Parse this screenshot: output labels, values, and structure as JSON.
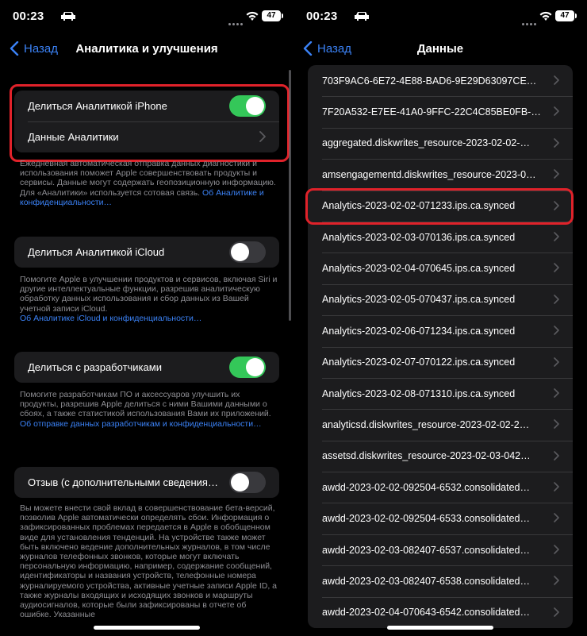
{
  "left": {
    "status": {
      "time": "00:23",
      "battery": "47"
    },
    "nav": {
      "back_label": "Назад",
      "title": "Аналитика и улучшения"
    },
    "group1": {
      "share_iphone": {
        "label": "Делиться Аналитикой iPhone",
        "on": true
      },
      "analytics_data": {
        "label": "Данные Аналитики"
      }
    },
    "footer1": {
      "text": "Ежедневная автоматическая отправка данных диагностики и использования поможет Apple совершенствовать продукты и сервисы. Данные могут содержать геопозиционную информацию. Для «Аналитики» используется сотовая связь. ",
      "link": "Об Аналитике и конфиденциальности…"
    },
    "icloud": {
      "label": "Делиться Аналитикой iCloud",
      "on": false
    },
    "footer2": {
      "text": "Помогите Apple в улучшении продуктов и сервисов, включая Siri и другие интеллектуальные функции, разрешив аналитическую обработку данных использования и сбор данных из Вашей учетной записи iCloud.",
      "link": "Об Аналитике iCloud и конфиденциальности…"
    },
    "developers": {
      "label": "Делиться с разработчиками",
      "on": true
    },
    "footer3": {
      "text": "Помогите разработчикам ПО и аксессуаров улучшить их продукты, разрешив Apple делиться с ними Вашими данными о сбоях, а также статистикой использования Вами их приложений. ",
      "link": "Об отправке данных разработчикам и конфиденциальности…"
    },
    "feedback": {
      "label": "Отзыв (с дополнительными сведения…",
      "on": false
    },
    "footer4": {
      "text": "Вы можете внести свой вклад в совершенствование бета-версий, позволив Apple автоматически определять сбои. Информация о зафиксированных проблемах передается в Apple в обобщенном виде для установления тенденций. На устройстве также может быть включено ведение дополнительных журналов, в том числе журналов телефонных звонков, которые могут включать персональную информацию, например, содержание сообщений, идентификаторы и названия устройств, телефонные номера журналируемого устройства, активные учетные записи Apple ID, а также журналы входящих и исходящих звонков и маршруты аудиосигналов, которые были зафиксированы в отчете об ошибке. Указанные"
    }
  },
  "right": {
    "status": {
      "time": "00:23",
      "battery": "47"
    },
    "nav": {
      "back_label": "Назад",
      "title": "Данные"
    },
    "items": [
      "703F9AC6-6E72-4E88-BAD6-9E29D63097CE…",
      "7F20A532-E7EE-41A0-9FFC-22C4C85BE0FB-…",
      "aggregated.diskwrites_resource-2023-02-02-…",
      "amsengagementd.diskwrites_resource-2023-0…",
      "Analytics-2023-02-02-071233.ips.ca.synced",
      "Analytics-2023-02-03-070136.ips.ca.synced",
      "Analytics-2023-02-04-070645.ips.ca.synced",
      "Analytics-2023-02-05-070437.ips.ca.synced",
      "Analytics-2023-02-06-071234.ips.ca.synced",
      "Analytics-2023-02-07-070122.ips.ca.synced",
      "Analytics-2023-02-08-071310.ips.ca.synced",
      "analyticsd.diskwrites_resource-2023-02-02-2…",
      "assetsd.diskwrites_resource-2023-02-03-042…",
      "awdd-2023-02-02-092504-6532.consolidated…",
      "awdd-2023-02-02-092504-6533.consolidated…",
      "awdd-2023-02-03-082407-6537.consolidated…",
      "awdd-2023-02-03-082407-6538.consolidated…",
      "awdd-2023-02-04-070643-6542.consolidated…"
    ]
  },
  "colors": {
    "accent": "#3b82f6",
    "toggle_on": "#34c759",
    "highlight": "#e0222a",
    "cell": "#1c1c1e"
  },
  "icons": [
    "car-icon",
    "wifi-icon",
    "battery-icon",
    "chevron-left-icon",
    "chevron-right-icon"
  ]
}
